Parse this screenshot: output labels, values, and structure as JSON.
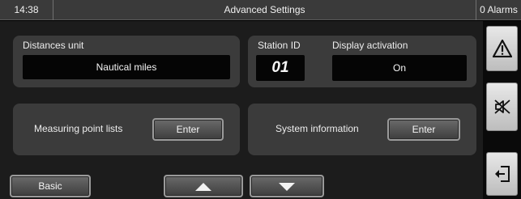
{
  "topbar": {
    "time": "14:38",
    "title": "Advanced Settings",
    "alarms": "0 Alarms"
  },
  "distances": {
    "label": "Distances unit",
    "value": "Nautical miles"
  },
  "station": {
    "label": "Station ID",
    "value": "01"
  },
  "display_activation": {
    "label": "Display activation",
    "value": "On"
  },
  "measuring_points": {
    "label": "Measuring point lists",
    "button": "Enter"
  },
  "system_info": {
    "label": "System information",
    "button": "Enter"
  },
  "bottom": {
    "basic_label": "Basic",
    "up_icon": "arrow-up-icon",
    "down_icon": "arrow-down-icon"
  },
  "sidebar": {
    "icons": [
      "warning-icon",
      "alarm-mute-icon",
      "exit-icon"
    ]
  }
}
